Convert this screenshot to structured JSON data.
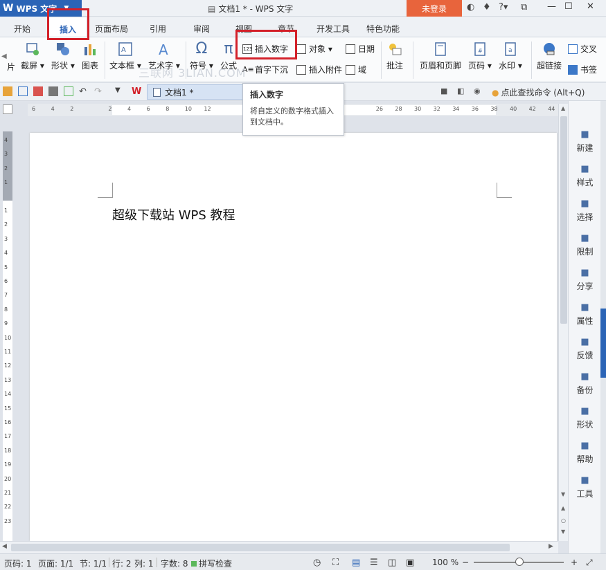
{
  "title_bar": {
    "app_name": "WPS 文字",
    "document_title": "文档1 * - WPS 文字",
    "login_label": "未登录",
    "help_label": "?"
  },
  "tabs": [
    {
      "label": "开始"
    },
    {
      "label": "插入"
    },
    {
      "label": "页面布局"
    },
    {
      "label": "引用"
    },
    {
      "label": "审阅"
    },
    {
      "label": "视图"
    },
    {
      "label": "章节"
    },
    {
      "label": "开发工具"
    },
    {
      "label": "特色功能"
    }
  ],
  "ribbon": {
    "screenshot": "截屏",
    "shapes": "形状",
    "chart": "图表",
    "textbox": "文本框",
    "wordart": "艺术字",
    "symbol": "符号",
    "formula": "公式",
    "insert_number": "插入数字",
    "object": "对象",
    "date": "日期",
    "first_char_sink": "首字下沉",
    "insert_attachment": "插入附件",
    "field": "域",
    "comment": "批注",
    "header_footer": "页眉和页脚",
    "page_number": "页码",
    "watermark_btn": "水印",
    "hyperlink": "超链接",
    "cross_ref": "交叉",
    "bookmark": "书签",
    "left_cut_label": "片"
  },
  "watermark": "三联网 3LIAN.COM",
  "quick_access": {
    "doc_tab": "文档1 *",
    "find_command": "点此查找命令 (Alt+Q)"
  },
  "tooltip": {
    "title": "插入数字",
    "description": "将自定义的数字格式插入到文档中。"
  },
  "ruler": {
    "h_ticks": [
      "6",
      "4",
      "2",
      "",
      "2",
      "4",
      "6",
      "8",
      "10",
      "12",
      "",
      "",
      "",
      "",
      "",
      "",
      "",
      "",
      "26",
      "28",
      "30",
      "32",
      "34",
      "36",
      "38",
      "40",
      "42",
      "44"
    ],
    "v_ticks": [
      "4",
      "3",
      "2",
      "1",
      "",
      "1",
      "2",
      "3",
      "4",
      "5",
      "6",
      "7",
      "8",
      "9",
      "10",
      "11",
      "12",
      "13",
      "14",
      "15",
      "16",
      "17",
      "18",
      "19",
      "20",
      "21",
      "22",
      "23"
    ]
  },
  "document": {
    "body_text": "超级下载站 WPS 教程"
  },
  "sidebar": [
    {
      "label": "新建",
      "icon": "new-doc-icon"
    },
    {
      "label": "样式",
      "icon": "style-icon"
    },
    {
      "label": "选择",
      "icon": "select-icon"
    },
    {
      "label": "限制",
      "icon": "restrict-icon"
    },
    {
      "label": "分享",
      "icon": "share-icon"
    },
    {
      "label": "属性",
      "icon": "properties-icon"
    },
    {
      "label": "反馈",
      "icon": "feedback-icon"
    },
    {
      "label": "备份",
      "icon": "backup-icon"
    },
    {
      "label": "形状",
      "icon": "shape-icon"
    },
    {
      "label": "帮助",
      "icon": "help-icon"
    },
    {
      "label": "工具",
      "icon": "toolbox-icon"
    }
  ],
  "status": {
    "page_code": "页码: 1",
    "page": "页面: 1/1",
    "section": "节: 1/1",
    "row": "行: 2",
    "col": "列: 1",
    "word_count": "字数: 8",
    "spell_check": "拼写检查",
    "zoom": "100 %"
  },
  "colors": {
    "accent": "#2b64b6",
    "login": "#e8643c",
    "highlight": "#d32029"
  }
}
